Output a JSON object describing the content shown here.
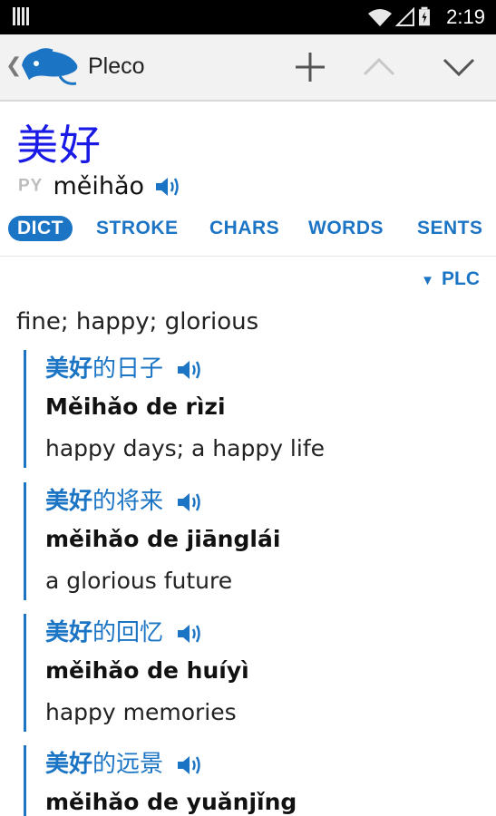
{
  "status": {
    "time": "2:19"
  },
  "appbar": {
    "title": "Pleco"
  },
  "entry": {
    "headword": "美好",
    "py_label": "PY",
    "pinyin": "měihǎo"
  },
  "tabs": [
    {
      "label": "DICT",
      "active": true
    },
    {
      "label": "STROKE"
    },
    {
      "label": "CHARS"
    },
    {
      "label": "WORDS"
    },
    {
      "label": "SENTS"
    }
  ],
  "dict_selector": "PLC",
  "definition": "fine; happy; glorious",
  "examples": [
    {
      "head": "美好",
      "rest": "的日子",
      "pinyin": "Měihǎo de rìzi",
      "english": "happy days; a happy life"
    },
    {
      "head": "美好",
      "rest": "的将来",
      "pinyin": "měihǎo de jiānglái",
      "english": "a glorious future"
    },
    {
      "head": "美好",
      "rest": "的回忆",
      "pinyin": "měihǎo de huíyì",
      "english": "happy memories"
    },
    {
      "head": "美好",
      "rest": "的远景",
      "pinyin": "měihǎo de yuǎnjǐng",
      "english": ""
    }
  ],
  "colors": {
    "accent": "#1b74c4",
    "headword": "#1a1ae6"
  },
  "icons": [
    "signal-icon",
    "wifi-icon",
    "battery-icon",
    "pleco-logo-icon",
    "add-icon",
    "chevron-up-icon",
    "chevron-down-icon",
    "speaker-icon"
  ]
}
